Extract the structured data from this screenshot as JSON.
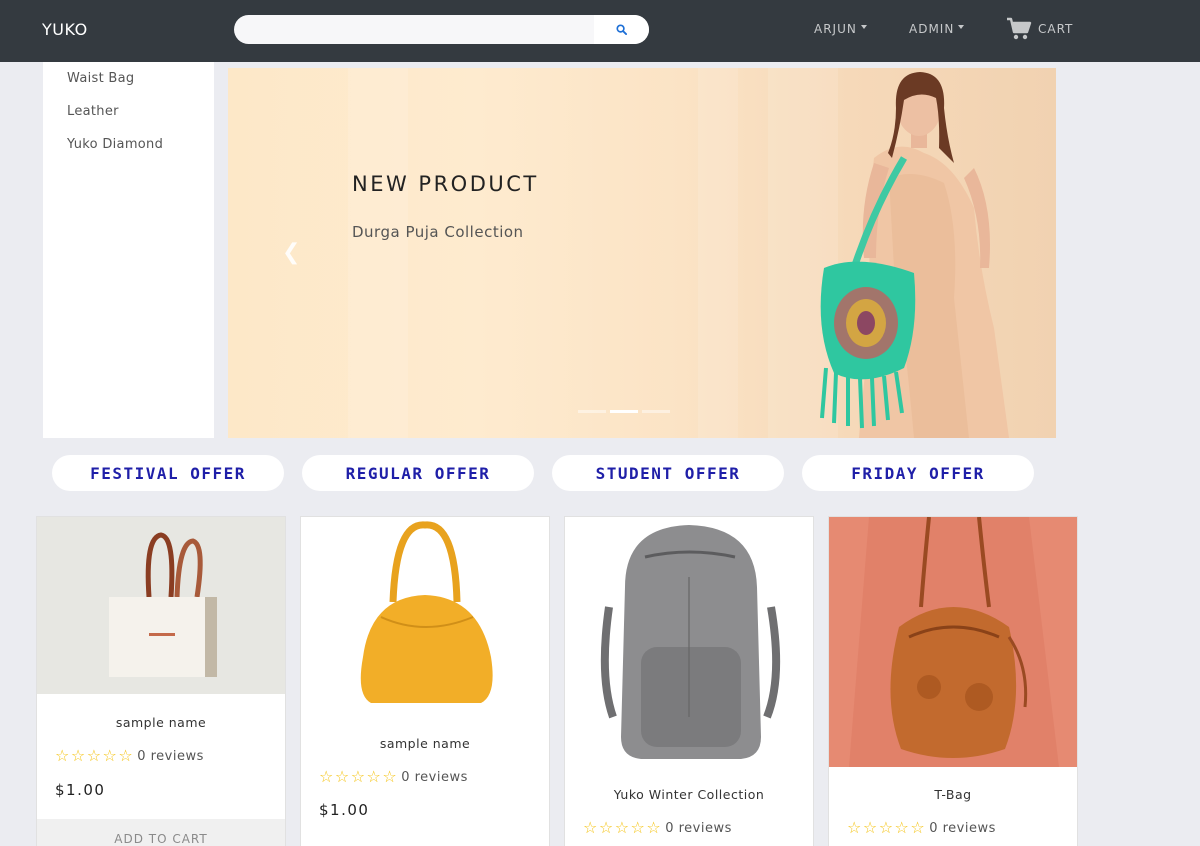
{
  "navbar": {
    "brand": "YUKO",
    "search_placeholder": "",
    "search_icon": "search-icon",
    "user_menu": "ARJUN",
    "admin_menu": "ADMIN",
    "cart_label": "CART",
    "cart_icon": "shopping-cart-icon",
    "background": "#343a40"
  },
  "sidebar": {
    "items": [
      {
        "label": "Waist Bag"
      },
      {
        "label": "Leather"
      },
      {
        "label": "Yuko Diamond"
      }
    ]
  },
  "carousel": {
    "title": "NEW PRODUCT",
    "subtitle": "Durga Puja Collection",
    "prev_icon": "chevron-left-icon",
    "slide_count": 3,
    "active_slide": 2
  },
  "offers": [
    {
      "label": "FESTIVAL OFFER"
    },
    {
      "label": "REGULAR OFFER"
    },
    {
      "label": "STUDENT OFFER"
    },
    {
      "label": "FRIDAY OFFER"
    }
  ],
  "offer_text_color": "#1f1fa8",
  "star_color": "#f5c518",
  "products": [
    {
      "name": "sample name",
      "reviews": "0 reviews",
      "price": "$1.00",
      "add_to_cart": "ADD TO CART",
      "stars": 0
    },
    {
      "name": "sample name",
      "reviews": "0 reviews",
      "price": "$1.00",
      "stars": 0
    },
    {
      "name": "Yuko Winter Collection",
      "reviews": "0 reviews",
      "stars": 0
    },
    {
      "name": "T-Bag",
      "reviews": "0 reviews",
      "stars": 0
    }
  ]
}
